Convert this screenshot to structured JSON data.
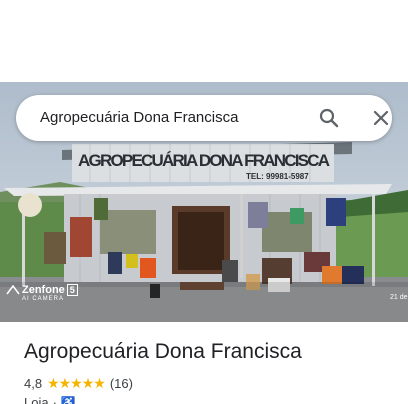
{
  "search": {
    "query": "Agropecuária Dona Francisca"
  },
  "photo": {
    "sign_text": "AGROPECUÁRIA DONA FRANCISCA",
    "sign_phone": "TEL: 99981-5987",
    "watermark_brand": "Zenfone",
    "watermark_model": "5",
    "watermark_sub": "AI CAMERA",
    "date_stamp": "21 de"
  },
  "place": {
    "title": "Agropecuária Dona Francisca",
    "rating": "4,8",
    "stars": "★★★★★",
    "review_count": "(16)",
    "category": "Loja",
    "separator": "·"
  },
  "icons": {
    "search": "search-icon",
    "close": "close-icon",
    "wheelchair": "wheelchair-icon"
  },
  "colors": {
    "star": "#f5b400",
    "accent": "#1a73e8",
    "text": "#202124"
  }
}
